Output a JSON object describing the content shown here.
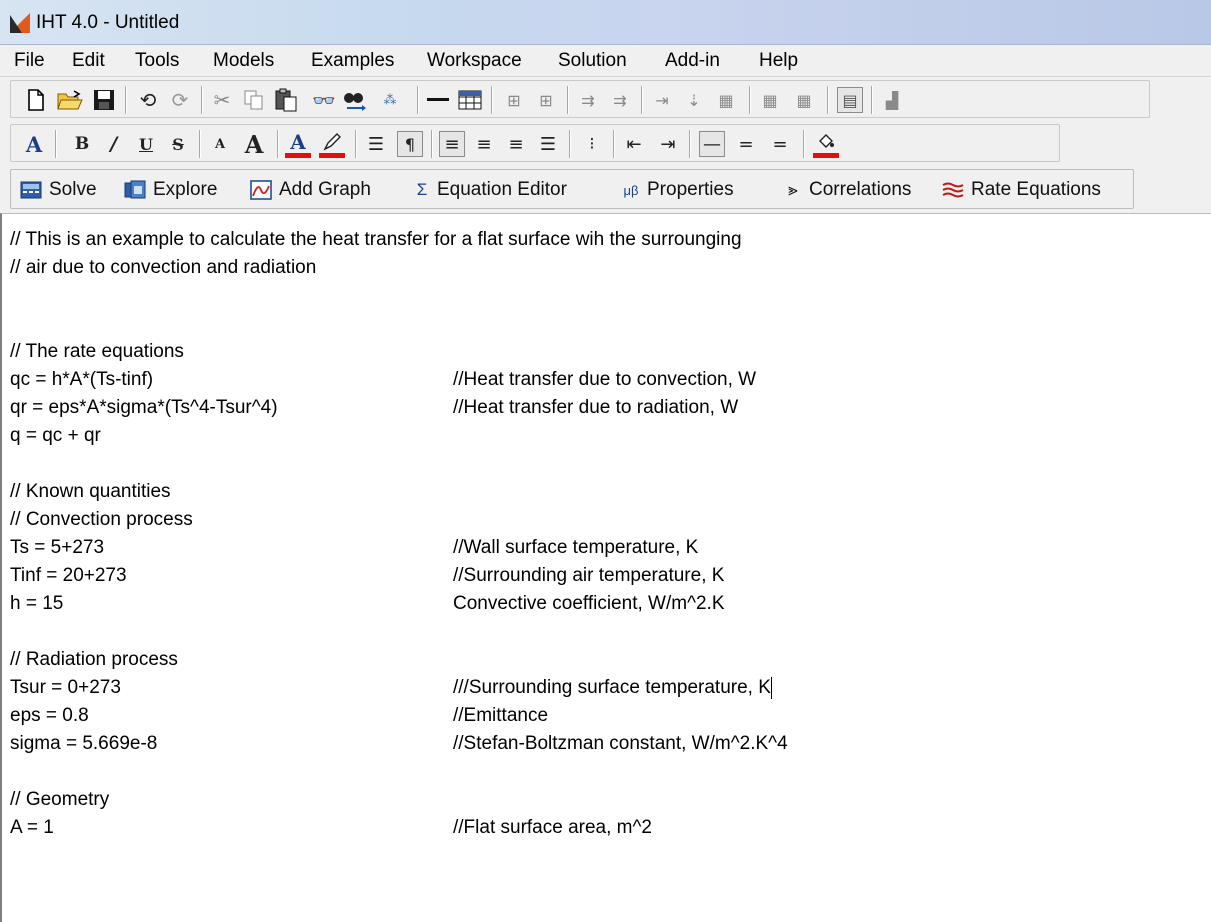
{
  "window": {
    "title": "IHT 4.0 - Untitled"
  },
  "menu": [
    "File",
    "Edit",
    "Tools",
    "Models",
    "Examples",
    "Workspace",
    "Solution",
    "Add-in",
    "Help"
  ],
  "toolbar_format": {
    "font_a": "A",
    "bold": "B",
    "italic": "/",
    "underline": "U",
    "strike": "S",
    "superscript": "A",
    "big": "A",
    "font_color": "A"
  },
  "toolbar_commands": {
    "solve": "Solve",
    "explore": "Explore",
    "add_graph": "Add Graph",
    "equation_editor": "Equation Editor",
    "properties": "Properties",
    "correlations": "Correlations",
    "rate_equations": "Rate Equations"
  },
  "editor": {
    "header1": "// This is an example to calculate the heat transfer for a flat surface wih the surrounging",
    "header2": "// air due to convection and radiation",
    "rate_title": "// The rate equations",
    "qc_eq": "qc = h*A*(Ts-tinf)",
    "qc_comment": "//Heat transfer due to convection, W",
    "qr_eq": "qr = eps*A*sigma*(Ts^4-Tsur^4)",
    "qr_comment": "//Heat transfer due to radiation, W",
    "q_eq": "q = qc + qr",
    "known_title": "// Known quantities",
    "conv_title": "// Convection process",
    "ts_eq": "Ts = 5+273",
    "ts_comment": "//Wall surface temperature, K",
    "tinf_eq": "Tinf = 20+273",
    "tinf_comment": "//Surrounding air temperature, K",
    "h_eq": "h = 15",
    "h_comment": "Convective coefficient, W/m^2.K",
    "rad_title": "// Radiation process",
    "tsur_eq": "Tsur = 0+273",
    "tsur_comment": "///Surrounding surface temperature, K",
    "eps_eq": "eps = 0.8",
    "eps_comment": "//Emittance",
    "sigma_eq": "sigma = 5.669e-8",
    "sigma_comment": "//Stefan-Boltzman constant, W/m^2.K^4",
    "geom_title": "// Geometry",
    "a_eq": "A = 1",
    "a_comment": "//Flat surface area, m^2"
  }
}
